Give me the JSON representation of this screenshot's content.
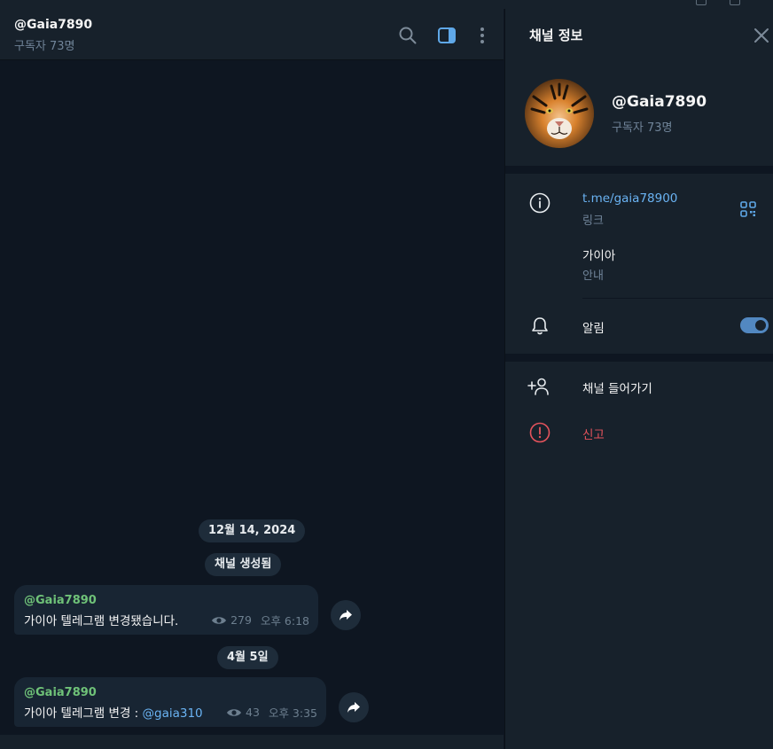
{
  "chat": {
    "title": "@Gaia7890",
    "subtitle": "구독자 73명",
    "date1": "12월 14, 2024",
    "service_msg": "채널 생성됨",
    "date2": "4월 5일",
    "messages": [
      {
        "author": "@Gaia7890",
        "text": "가이아 텔레그램 변경됐습니다.",
        "views": "279",
        "time": "오후 6:18"
      },
      {
        "author": "@Gaia7890",
        "text_prefix": "가이아 텔레그램 변경 : ",
        "mention": "@gaia310",
        "views": "43",
        "time": "오후 3:35"
      }
    ]
  },
  "panel": {
    "title": "채널 정보",
    "name": "@Gaia7890",
    "subscribers": "구독자 73명",
    "link": "t.me/gaia78900",
    "link_label": "링크",
    "description": "가이아",
    "description_label": "안내",
    "notifications_label": "알림",
    "notifications_on": true,
    "join_label": "채널 들어가기",
    "report_label": "신고"
  },
  "icons": {
    "search": "search-icon",
    "sidebar": "sidebar-toggle-icon",
    "more": "more-vertical-icon",
    "close": "close-icon",
    "info": "info-icon",
    "qr": "qr-code-icon",
    "bell": "bell-icon",
    "add_user": "add-user-icon",
    "report": "report-icon",
    "eye": "eye-icon",
    "share": "share-arrow-icon"
  },
  "colors": {
    "accent": "#5288c1",
    "link": "#6ab3f3",
    "author": "#6fc278",
    "danger": "#e5535c",
    "background": "#0e1621",
    "panel": "#17212b"
  }
}
